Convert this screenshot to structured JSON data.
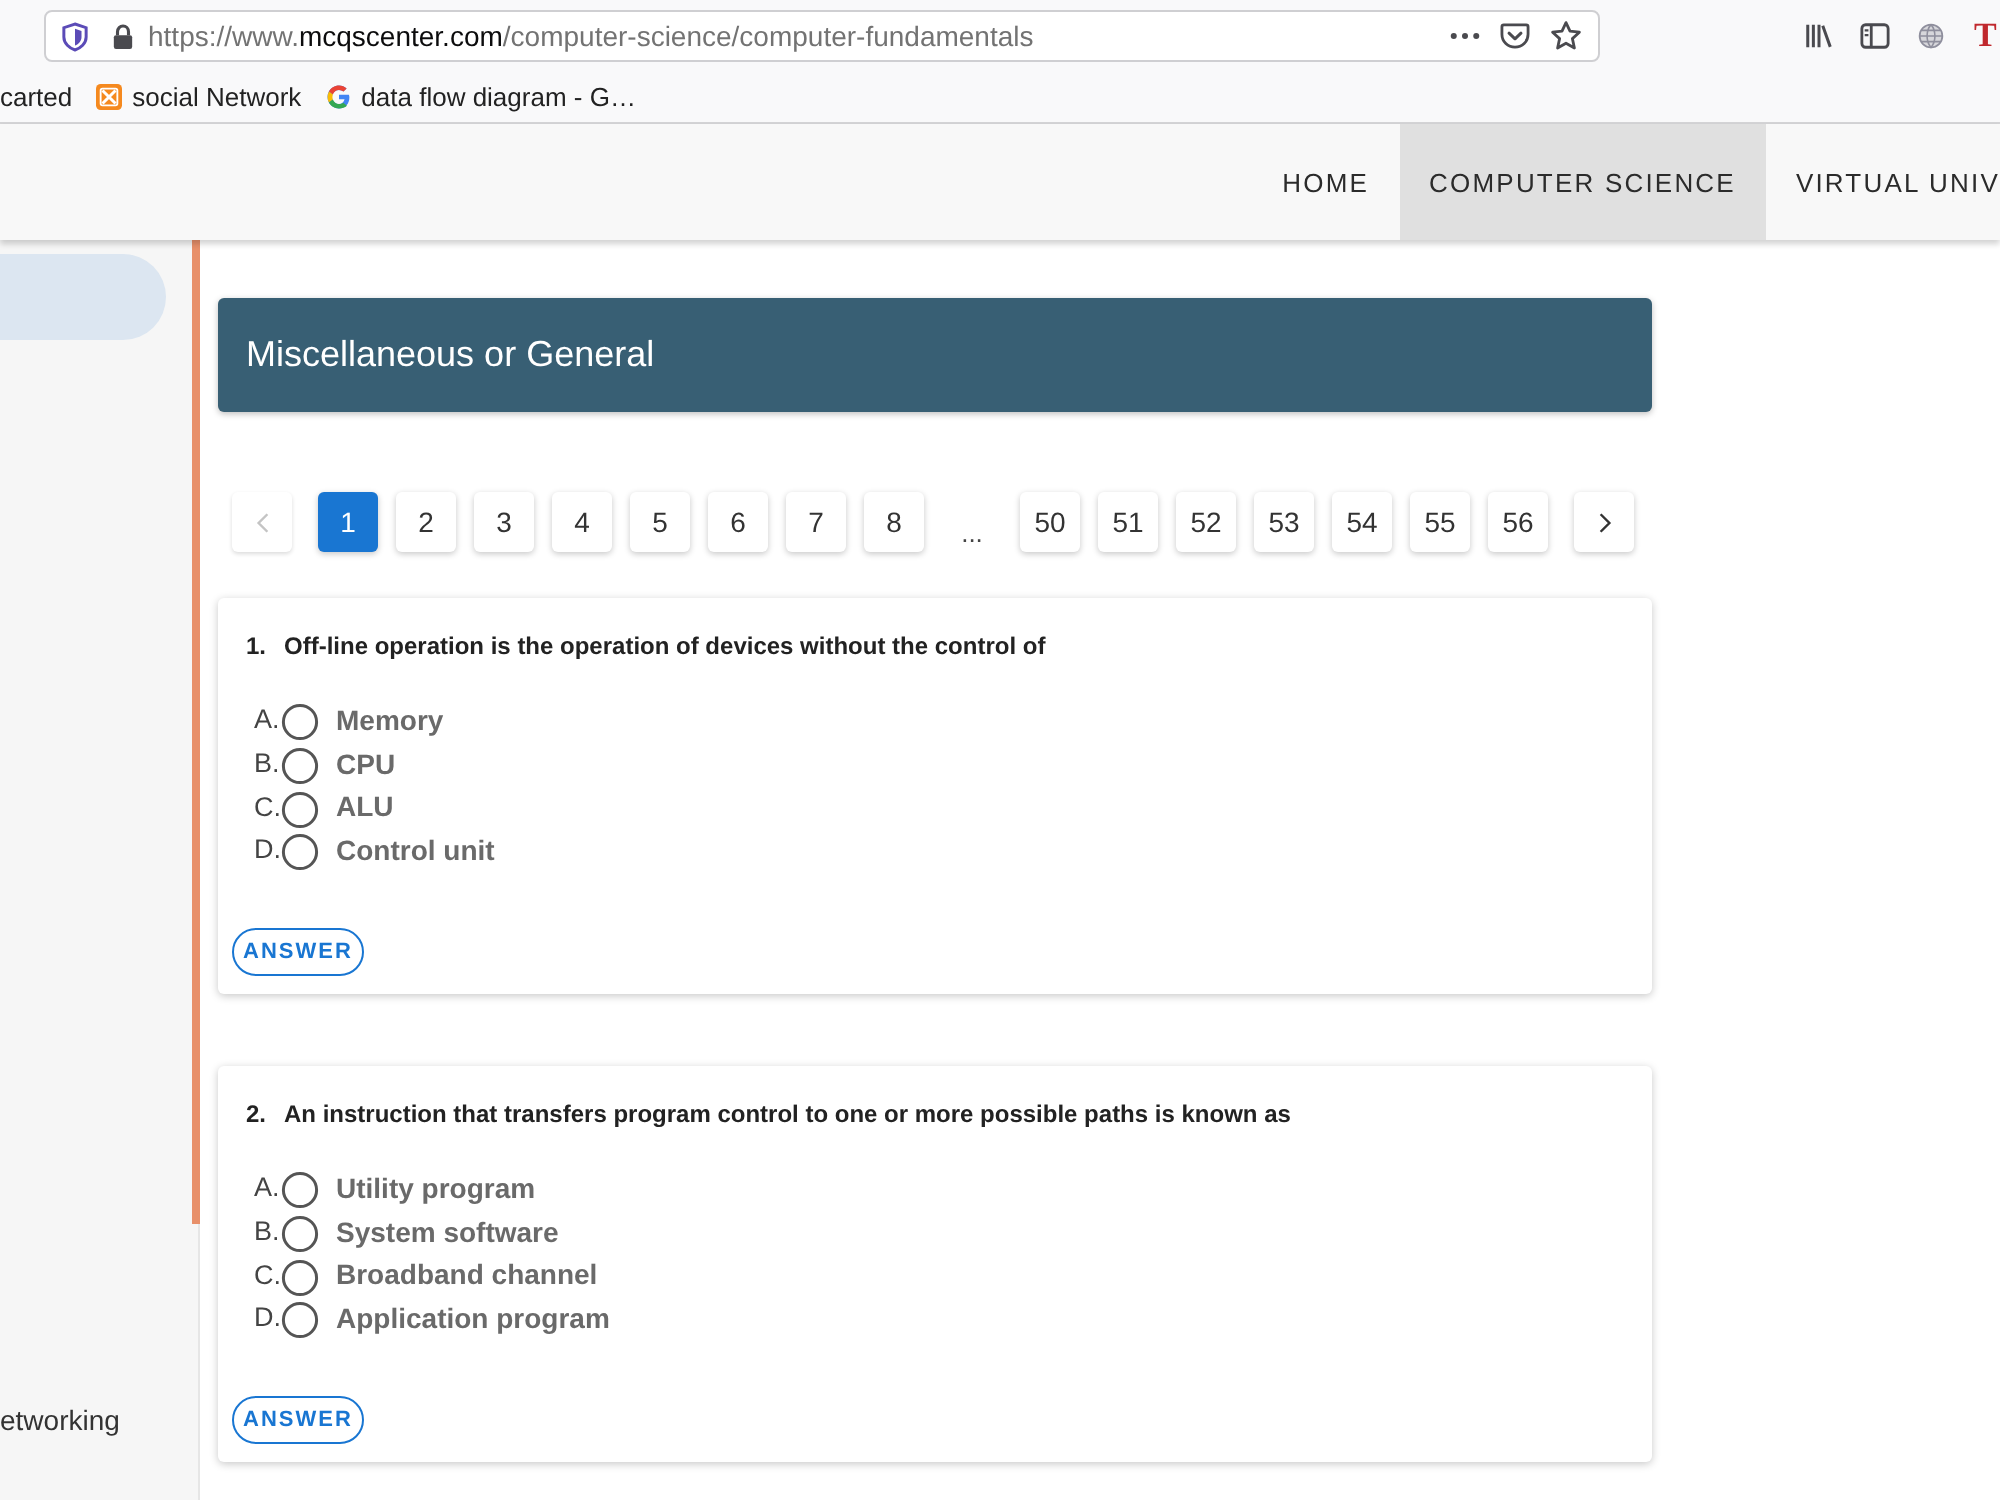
{
  "browser": {
    "url": {
      "prefix": "https://www.",
      "domain": "mcqscenter.com",
      "path": "/computer-science/computer-fundamentals"
    },
    "extension_letter": "T"
  },
  "bookmarks": [
    {
      "label": "carted",
      "kind": "plain"
    },
    {
      "label": "social Network",
      "kind": "tile"
    },
    {
      "label": "data flow diagram - G…",
      "kind": "letter"
    }
  ],
  "nav": [
    {
      "label": "HOME",
      "selected": false
    },
    {
      "label": "COMPUTER SCIENCE",
      "selected": true
    },
    {
      "label": "VIRTUAL UNIV",
      "selected": false
    }
  ],
  "sidebar": {
    "items": [
      {
        "selected": true
      },
      {
        "label": "etworking",
        "selected": false
      }
    ]
  },
  "section_title": "Miscellaneous or General",
  "pagination": [
    {
      "kind": "prev",
      "disabled": true
    },
    {
      "kind": "page",
      "label": "1",
      "selected": true
    },
    {
      "kind": "page",
      "label": "2",
      "selected": false
    },
    {
      "kind": "page",
      "label": "3",
      "selected": false
    },
    {
      "kind": "page",
      "label": "4",
      "selected": false
    },
    {
      "kind": "page",
      "label": "5",
      "selected": false
    },
    {
      "kind": "page",
      "label": "6",
      "selected": false
    },
    {
      "kind": "page",
      "label": "7",
      "selected": false
    },
    {
      "kind": "page",
      "label": "8",
      "selected": false
    },
    {
      "kind": "gap",
      "label": "..."
    },
    {
      "kind": "page",
      "label": "50",
      "selected": false
    },
    {
      "kind": "page",
      "label": "51",
      "selected": false
    },
    {
      "kind": "page",
      "label": "52",
      "selected": false
    },
    {
      "kind": "page",
      "label": "53",
      "selected": false
    },
    {
      "kind": "page",
      "label": "54",
      "selected": false
    },
    {
      "kind": "page",
      "label": "55",
      "selected": false
    },
    {
      "kind": "page",
      "label": "56",
      "selected": false
    },
    {
      "kind": "next",
      "disabled": false
    }
  ],
  "questions": [
    {
      "number": "1.",
      "text": "Off-line operation is the operation of devices without the control of",
      "options": [
        {
          "letter": "A.",
          "text": "Memory",
          "selected": false
        },
        {
          "letter": "B.",
          "text": "CPU",
          "selected": false
        },
        {
          "letter": "C.",
          "text": "ALU",
          "selected": false
        },
        {
          "letter": "D.",
          "text": "Control unit",
          "selected": false
        }
      ],
      "answer_button": "ANSWER"
    },
    {
      "number": "2.",
      "text": "An instruction that transfers program control to one or more possible paths is known as",
      "options": [
        {
          "letter": "A.",
          "text": "Utility program",
          "selected": false
        },
        {
          "letter": "B.",
          "text": "System software",
          "selected": false
        },
        {
          "letter": "C.",
          "text": "Broadband channel",
          "selected": false
        },
        {
          "letter": "D.",
          "text": "Application program",
          "selected": false
        }
      ],
      "answer_button": "ANSWER"
    }
  ]
}
